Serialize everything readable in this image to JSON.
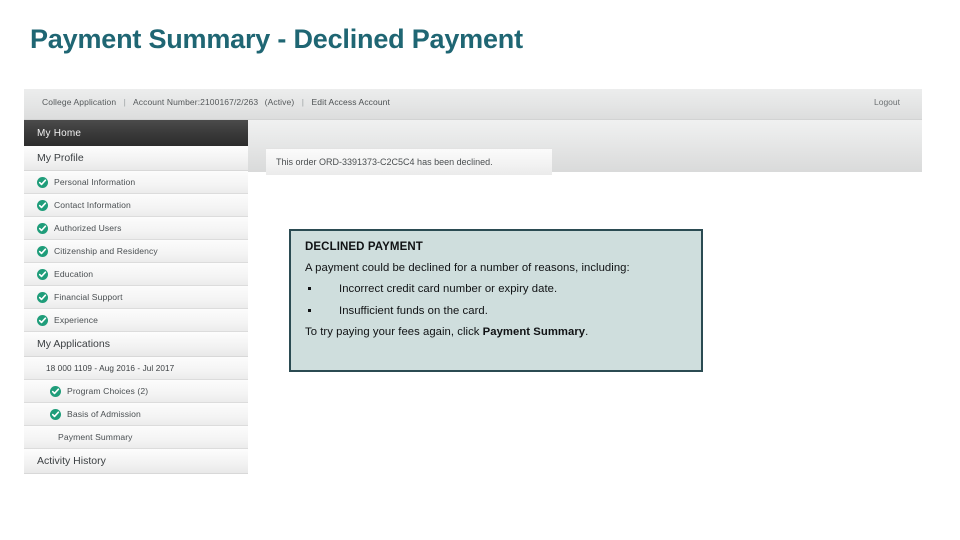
{
  "slide": {
    "title": "Payment Summary - Declined Payment",
    "title_color": "#1f6673"
  },
  "screenshot": {
    "topbar": {
      "app_name": "College Application",
      "separator": "|",
      "account_number_label": "Account Number:2100167/2/263",
      "account_status": "(Active)",
      "edit_access_link": "Edit Access Account",
      "logout_link": "Logout"
    },
    "sidebar": {
      "active_tab": "My Home",
      "groups": [
        {
          "label": "My Profile",
          "items": [
            {
              "label": "Personal Information",
              "checked": true
            },
            {
              "label": "Contact Information",
              "checked": true
            },
            {
              "label": "Authorized Users",
              "checked": true
            },
            {
              "label": "Citizenship and Residency",
              "checked": true
            },
            {
              "label": "Education",
              "checked": true
            },
            {
              "label": "Financial Support",
              "checked": true
            },
            {
              "label": "Experience",
              "checked": true
            }
          ]
        },
        {
          "label": "My Applications",
          "application": "18 000 1109 - Aug 2016 - Jul 2017",
          "items": [
            {
              "label": "Program Choices (2)",
              "checked": true
            },
            {
              "label": "Basis of Admission",
              "checked": true
            },
            {
              "label": "Payment Summary",
              "checked": false
            }
          ]
        }
      ],
      "footer_group": "Activity History"
    },
    "content": {
      "declined_message": "This order ORD-3391373-C2C5C4 has been declined."
    }
  },
  "callout": {
    "title": "DECLINED PAYMENT",
    "intro": "A payment could be declined for a number of reasons, including:",
    "reasons": [
      "Incorrect credit card number or expiry date.",
      "Insufficient funds on the card."
    ],
    "footer_prefix": "To try paying your fees again, click ",
    "footer_link": "Payment Summary",
    "footer_suffix": ".",
    "background_color": "#cfdedd",
    "border_color": "#2b4b52"
  }
}
